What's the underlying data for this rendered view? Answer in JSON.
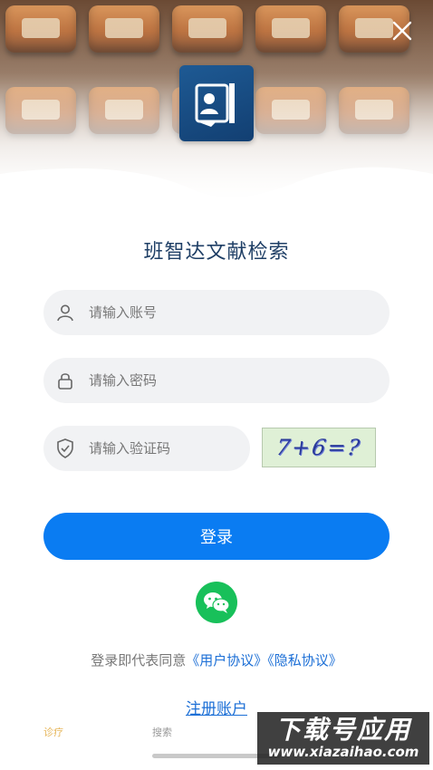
{
  "header": {
    "close_icon": "close-icon"
  },
  "app": {
    "title": "班智达文献检索"
  },
  "form": {
    "account_placeholder": "请输入账号",
    "password_placeholder": "请输入密码",
    "captcha_placeholder": "请输入验证码",
    "captcha_image_text": "7+6=?",
    "login_label": "登录"
  },
  "agreement": {
    "prefix": "登录即代表同意",
    "user_agreement": "《用户协议》",
    "privacy_policy": "《隐私协议》"
  },
  "register_label": "注册账户",
  "tabbar": {
    "tab1": "诊疗",
    "tab2": "搜索"
  },
  "watermark": {
    "top": "下载号应用",
    "bottom": "www.xiazaihao.com"
  },
  "colors": {
    "primary": "#0a7cf2",
    "wechat": "#18c05a",
    "title": "#1f3f66",
    "link": "#1c6fd6"
  }
}
